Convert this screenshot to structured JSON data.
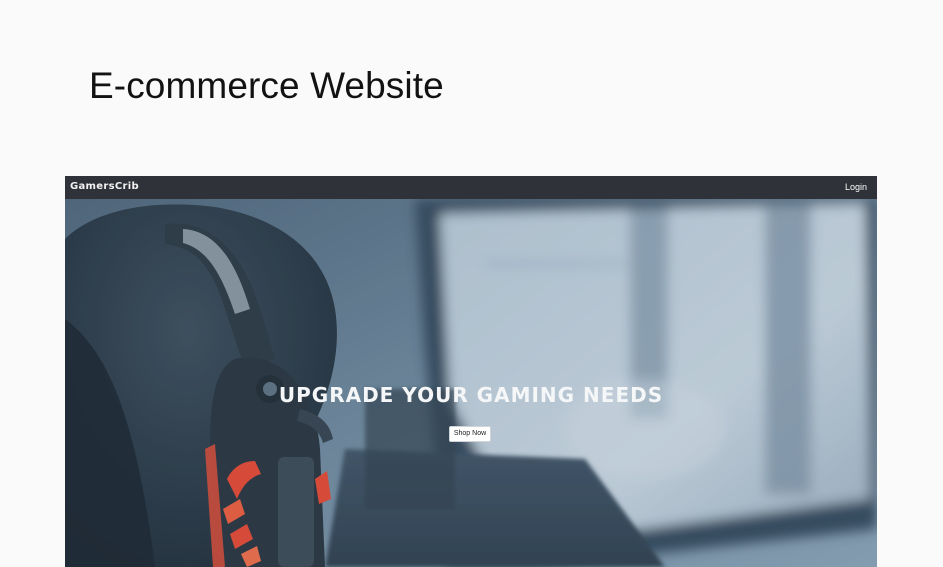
{
  "page": {
    "title": "E-commerce Website"
  },
  "site": {
    "brand": "GamersCrib",
    "nav": {
      "login_label": "Login"
    },
    "hero": {
      "heading": "UPGRADE YOUR GAMING NEEDS",
      "cta_label": "Shop Now",
      "image_subject": "gamer-with-red-led-headset-facing-monitor"
    }
  },
  "colors": {
    "page_background": "#fafafa",
    "navbar_background": "#2f3238",
    "hero_tint": "#5a7288",
    "headset_accent": "#e8452f"
  }
}
